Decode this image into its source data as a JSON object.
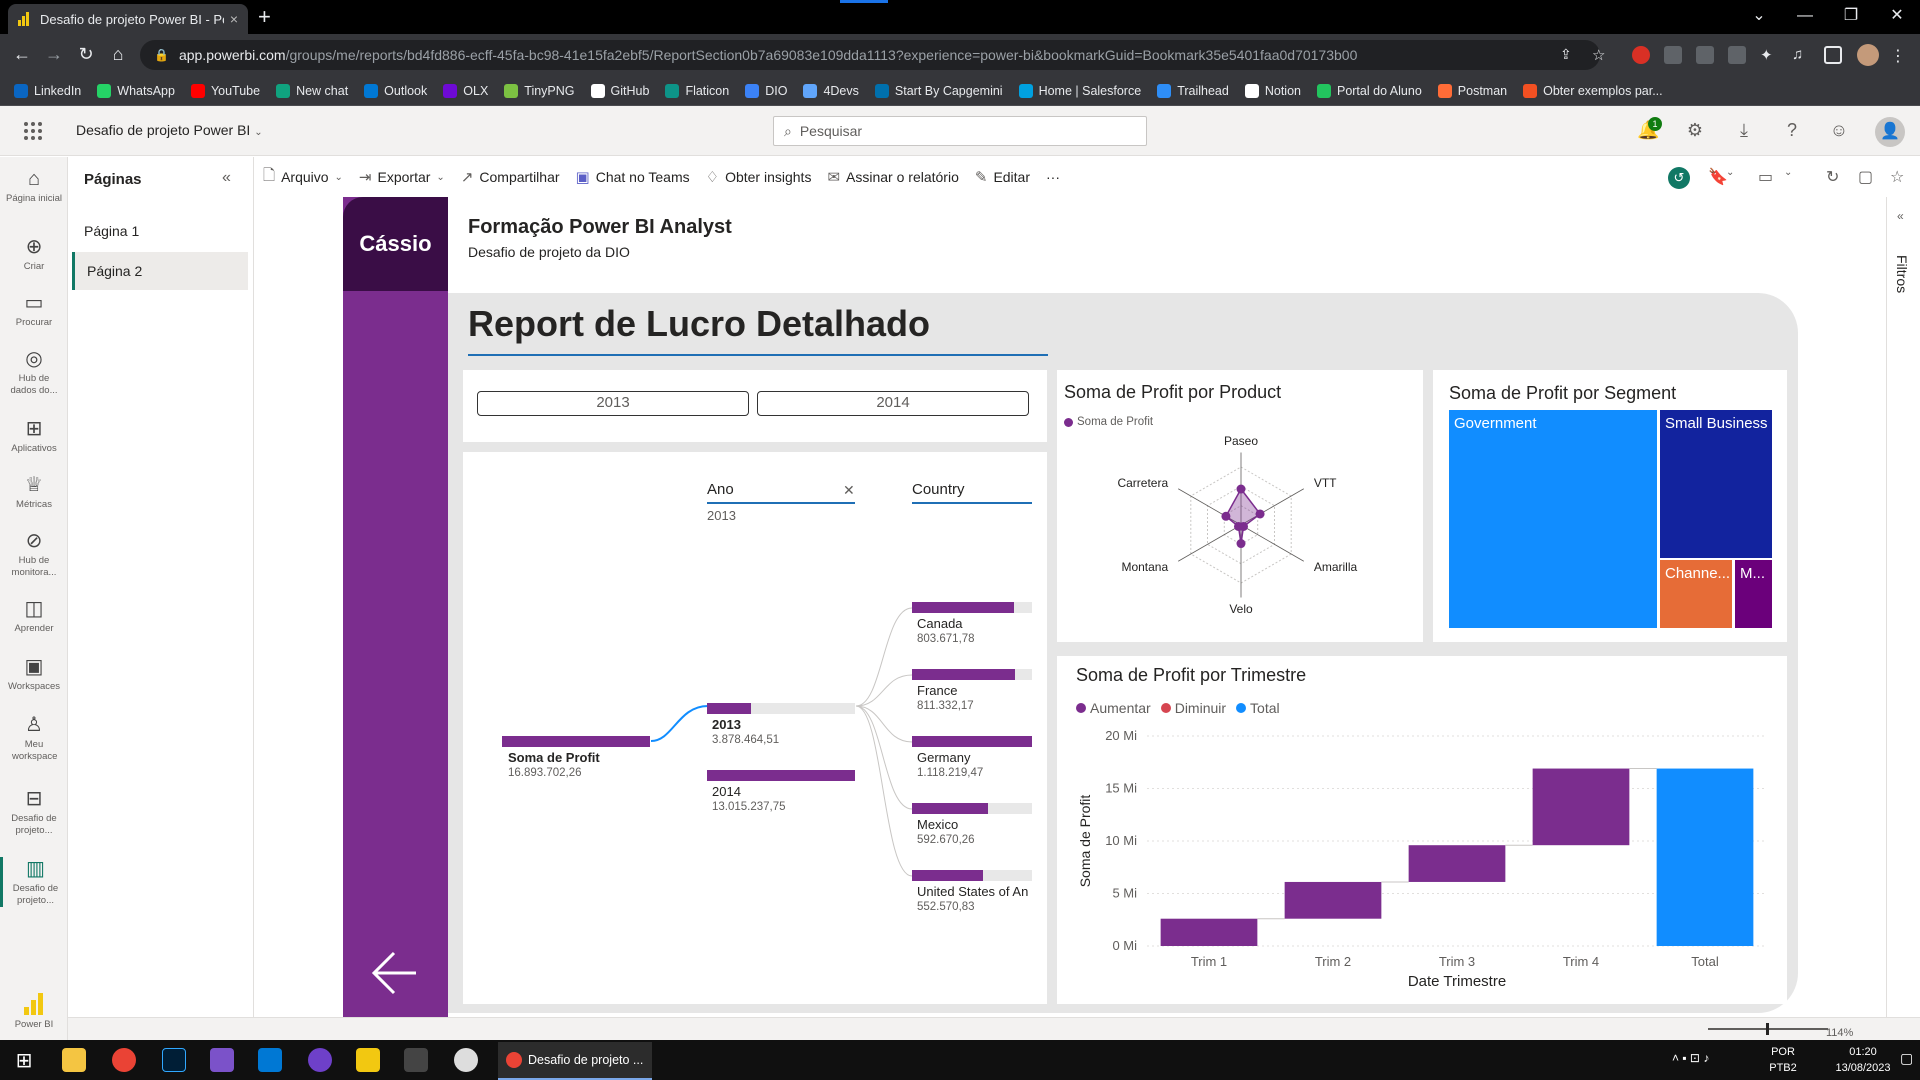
{
  "browser": {
    "tab_title": "Desafio de projeto Power BI - Po",
    "tab_close": "×",
    "new_tab": "+",
    "url_domain": "app.powerbi.com",
    "url_path": "/groups/me/reports/bd4fd886-ecff-45fa-bc98-41e15fa2ebf5/ReportSection0b7a69083e109dda1113?experience=power-bi&bookmarkGuid=Bookmark35e5401faa0d70173b00",
    "bookmarks": [
      "LinkedIn",
      "WhatsApp",
      "YouTube",
      "New chat",
      "Outlook",
      "OLX",
      "TinyPNG",
      "GitHub",
      "Flaticon",
      "DIO",
      "4Devs",
      "Start By Capgemini",
      "Home | Salesforce",
      "Trailhead",
      "Notion",
      "Portal do Aluno",
      "Postman",
      "Obter exemplos par..."
    ],
    "bookmark_colors": [
      "#0a66c2",
      "#25d366",
      "#ff0000",
      "#10a37f",
      "#0078d4",
      "#6e0ad6",
      "#7cc142",
      "#ffffff",
      "#0d9488",
      "#3b82f6",
      "#60a5fa",
      "#0070ad",
      "#00a1e0",
      "#2e8ef7",
      "#ffffff",
      "#22c55e",
      "#ff6c37",
      "#f25022"
    ]
  },
  "pbi_header": {
    "report_name": "Desafio de projeto Power BI",
    "search_placeholder": "Pesquisar",
    "notifications_count": "1"
  },
  "left_nav": [
    {
      "label": "Página inicial",
      "icon": "home-icon"
    },
    {
      "label": "Criar",
      "icon": "plus-icon"
    },
    {
      "label": "Procurar",
      "icon": "folder-icon"
    },
    {
      "label": "Hub de dados do...",
      "icon": "data-hub-icon"
    },
    {
      "label": "Aplicativos",
      "icon": "apps-icon"
    },
    {
      "label": "Métricas",
      "icon": "trophy-icon"
    },
    {
      "label": "Hub de monitora...",
      "icon": "monitor-icon"
    },
    {
      "label": "Aprender",
      "icon": "book-icon"
    },
    {
      "label": "Workspaces",
      "icon": "workspaces-icon"
    },
    {
      "label": "Meu workspace",
      "icon": "user-icon"
    },
    {
      "label": "Desafio de projeto...",
      "icon": "dataset-icon"
    },
    {
      "label": "Desafio de projeto...",
      "icon": "report-icon"
    },
    {
      "label": "Power BI",
      "icon": "powerbi-icon"
    }
  ],
  "pages_pane": {
    "title": "Páginas",
    "pages": [
      "Página 1",
      "Página 2"
    ],
    "selected": "Página 2"
  },
  "actionbar": {
    "arquivo": "Arquivo",
    "exportar": "Exportar",
    "compartilhar": "Compartilhar",
    "chat_teams": "Chat no Teams",
    "insights": "Obter insights",
    "assinar": "Assinar o relatório",
    "editar": "Editar",
    "more": "···"
  },
  "filters_label": "Filtros",
  "report": {
    "logo_text": "Cássio",
    "header_title": "Formação Power BI Analyst",
    "header_subtitle": "Desafio de projeto da DIO",
    "page_title": "Report de Lucro Detalhado",
    "slicer": [
      "2013",
      "2014"
    ],
    "decomp_tree": {
      "root_label": "Soma de Profit",
      "root_value": "16.893.702,26",
      "col1_header": "Ano",
      "col1_filter": "2013",
      "col2_header": "Country",
      "ano_nodes": [
        {
          "label": "2013",
          "value": "3.878.464,51",
          "fill": 0.3
        },
        {
          "label": "2014",
          "value": "13.015.237,75",
          "fill": 1.0
        }
      ],
      "country_nodes": [
        {
          "label": "Canada",
          "value": "803.671,78",
          "fill": 0.85
        },
        {
          "label": "France",
          "value": "811.332,17",
          "fill": 0.86
        },
        {
          "label": "Germany",
          "value": "1.118.219,47",
          "fill": 1.0
        },
        {
          "label": "Mexico",
          "value": "592.670,26",
          "fill": 0.63
        },
        {
          "label": "United States of An",
          "value": "552.570,83",
          "fill": 0.59
        }
      ]
    },
    "radar": {
      "title": "Soma de Profit por Product",
      "legend": "Soma de Profit",
      "axes": [
        "Paseo",
        "VTT",
        "Amarilla",
        "Velo",
        "Montana",
        "Carretera"
      ],
      "values": [
        0.62,
        0.38,
        0.05,
        0.32,
        0.05,
        0.3
      ],
      "color": "#7b2d8e"
    },
    "treemap": {
      "title": "Soma de Profit por Segment",
      "segments": [
        {
          "label": "Government",
          "color": "#118dff"
        },
        {
          "label": "Small Business",
          "color": "#12239e"
        },
        {
          "label": "Channe...",
          "color": "#e66c37"
        },
        {
          "label": "M...",
          "color": "#6b007b"
        }
      ]
    }
  },
  "chart_data": {
    "type": "bar",
    "title": "Soma de Profit por Trimestre",
    "xlabel": "Date Trimestre",
    "ylabel": "Soma de Profit",
    "categories": [
      "Trim 1",
      "Trim 2",
      "Trim 3",
      "Trim 4",
      "Total"
    ],
    "waterfall_start": [
      0,
      2.6,
      6.1,
      9.6,
      0
    ],
    "waterfall_end": [
      2.6,
      6.1,
      9.6,
      16.9,
      16.9
    ],
    "ylim": [
      0,
      20
    ],
    "yticks": [
      "0 Mi",
      "5 Mi",
      "10 Mi",
      "15 Mi",
      "20 Mi"
    ],
    "legend": [
      "Aumentar",
      "Diminuir",
      "Total"
    ],
    "colors": {
      "increase": "#7b2d8e",
      "decrease": "#d64550",
      "total": "#118dff"
    },
    "legend_position": "top-left",
    "grid": true
  },
  "status": {
    "zoom": "114%"
  },
  "taskbar": {
    "chrome_task": "Desafio de projeto ...",
    "lang": "POR",
    "layout": "PTB2",
    "time": "01:20",
    "date": "13/08/2023"
  }
}
